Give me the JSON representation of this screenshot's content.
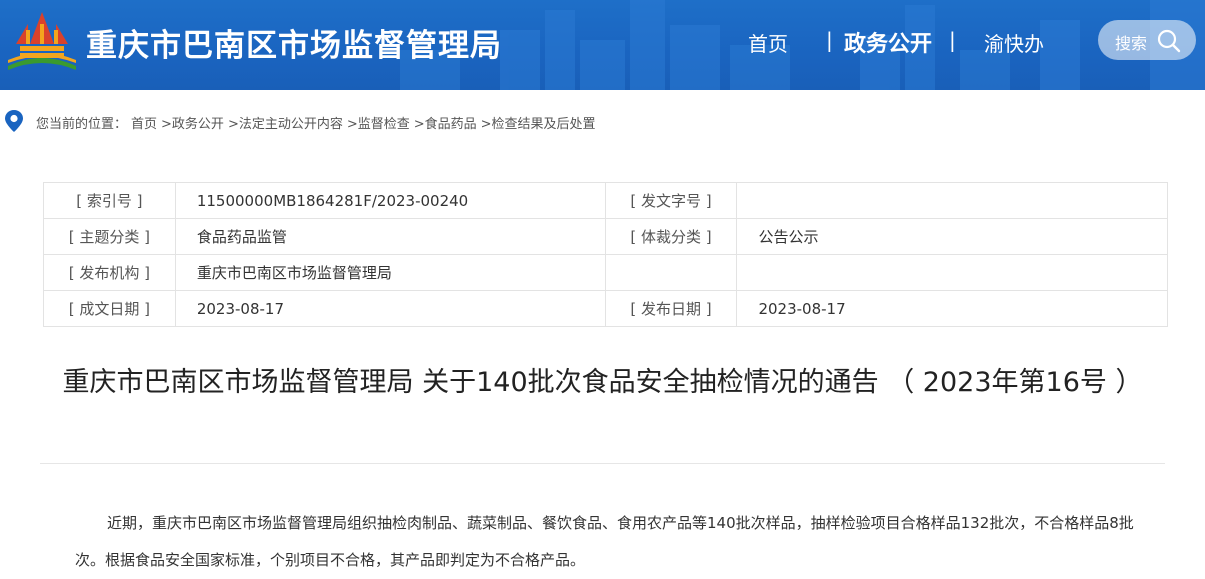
{
  "header": {
    "site_title": "重庆市巴南区市场监督管理局",
    "nav": {
      "home": "首页",
      "separator": "|",
      "gov_open": "政务公开",
      "yukuaiban": "渝快办"
    },
    "search_label": "搜索",
    "colors": {
      "brand_blue": "#1a64c0",
      "logo_red": "#d9422c",
      "logo_orange": "#f3a51e",
      "logo_green": "#3a9a2e"
    }
  },
  "breadcrumb": {
    "prefix": "您当前的位置：",
    "items": [
      "首页",
      ">政务公开",
      ">法定主动公开内容",
      ">监督检查",
      ">食品药品",
      ">检查结果及后处置"
    ]
  },
  "info_table": {
    "rows": [
      {
        "label1": "[ 索引号 ]",
        "value1": "11500000MB1864281F/2023-00240",
        "label2": "[ 发文字号 ]",
        "value2": ""
      },
      {
        "label1": "[ 主题分类 ]",
        "value1": "食品药品监管",
        "label2": "[ 体裁分类 ]",
        "value2": "公告公示"
      },
      {
        "label1": "[ 发布机构 ]",
        "value1": "重庆市巴南区市场监督管理局",
        "label2": "",
        "value2": ""
      },
      {
        "label1": "[ 成文日期 ]",
        "value1": "2023-08-17",
        "label2": "[ 发布日期 ]",
        "value2": "2023-08-17"
      }
    ]
  },
  "document": {
    "title": "重庆市巴南区市场监督管理局 关于140批次食品安全抽检情况的通告 （ 2023年第16号 ）",
    "body": "近期，重庆市巴南区市场监督管理局组织抽检肉制品、蔬菜制品、餐饮食品、食用农产品等140批次样品，抽样检验项目合格样品132批次，不合格样品8批次。根据食品安全国家标准，个别项目不合格，其产品即判定为不合格产品。"
  }
}
